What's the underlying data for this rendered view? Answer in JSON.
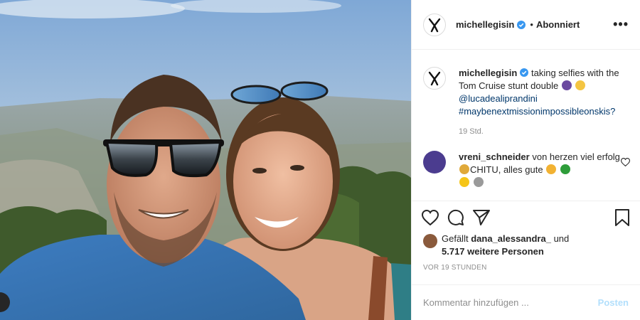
{
  "header": {
    "username": "michellegisin",
    "separator": "•",
    "follow_status": "Abonniert",
    "more_label": "•••"
  },
  "caption": {
    "username": "michellegisin",
    "text": "taking selfies with the Tom Cruise stunt double",
    "mention": "@lucadealiprandini",
    "hashtag": "#maybenextmissionimpossibleonskis?",
    "time": "19 Std."
  },
  "comment": {
    "username": "vreni_schneider",
    "text_part1": "von herzen viel erfolg",
    "text_part2": "CHITU, alles gute"
  },
  "likes": {
    "prefix": "Gefällt",
    "user": "dana_alessandra_",
    "suffix": "und",
    "count_text": "5.717 weitere Personen"
  },
  "timestamp": "VOR 19 STUNDEN",
  "add_comment": {
    "placeholder": "Kommentar hinzufügen ...",
    "post_label": "Posten"
  },
  "icons": {
    "like": "heart-icon",
    "comment": "comment-icon",
    "share": "paper-plane-icon",
    "save": "bookmark-icon",
    "verified": "verified-badge-icon"
  },
  "colors": {
    "verified": "#3897f0",
    "link": "#00376b",
    "muted": "#8e8e8e",
    "post_disabled": "#b2dffc"
  }
}
